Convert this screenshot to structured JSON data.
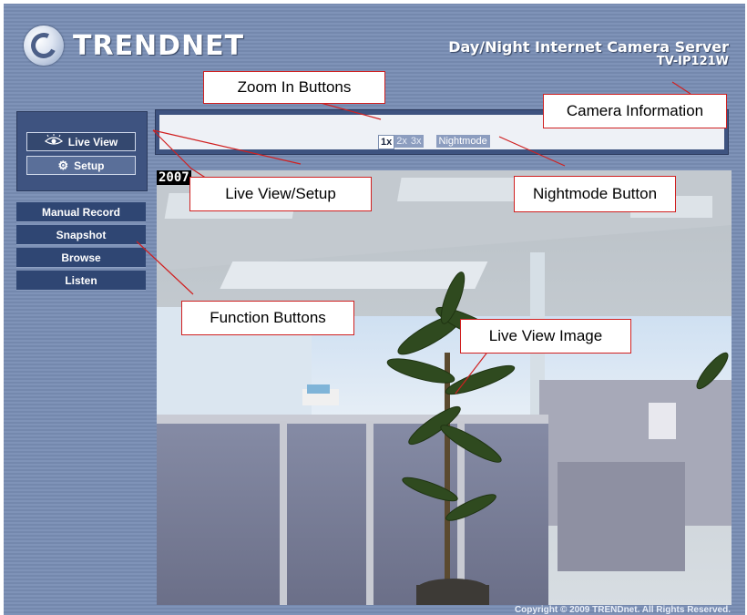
{
  "header": {
    "logo_text": "TRENDNET",
    "camera_title": "Day/Night Internet Camera Server",
    "camera_model": "TV-IP121W"
  },
  "sidebar": {
    "live_view_label": "Live View",
    "setup_label": "Setup",
    "live_view_icon": "eye-icon",
    "setup_icon": "gear-icon",
    "functions": [
      "Manual Record",
      "Snapshot",
      "Browse",
      "Listen"
    ]
  },
  "zoom": {
    "buttons": [
      "1x",
      "2x",
      "3x"
    ],
    "active": "1x",
    "nightmode_label": "Nightmode"
  },
  "live_view": {
    "timestamp": "2007"
  },
  "footer": {
    "copyright": "Copyright © 2009 TRENDnet. All Rights Reserved."
  },
  "callouts": {
    "zoom_in": "Zoom In Buttons",
    "camera_info": "Camera Information",
    "live_setup": "Live View/Setup",
    "nightmode": "Nightmode Button",
    "function_buttons": "Function Buttons",
    "live_image": "Live View Image"
  },
  "colors": {
    "frame_blue": "#7f93b8",
    "button_navy": "#2f4673",
    "callout_border": "#d02020"
  }
}
